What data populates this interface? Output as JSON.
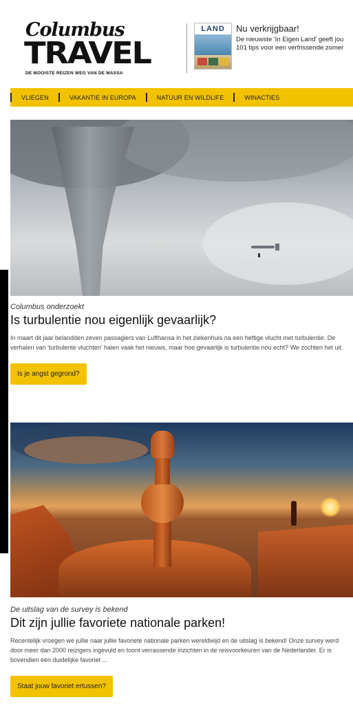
{
  "header": {
    "logo": {
      "script": "Columbus",
      "main": "TRAVEL",
      "tagline": "DE MOOISTE REIZEN WEG VAN DE MASSA"
    },
    "promo": {
      "magazine_masthead": "LAND",
      "title": "Nu verkrijgbaar!",
      "description": "De nieuwste 'In Eigen Land' geeft jou 101 tips voor een verfrissende zomer"
    }
  },
  "nav": {
    "items": [
      {
        "label": "VLIEGEN"
      },
      {
        "label": "VAKANTIE IN EUROPA"
      },
      {
        "label": "NATUUR EN WILDLIFE"
      },
      {
        "label": "WINACTIES"
      }
    ]
  },
  "articles": [
    {
      "kicker": "Columbus onderzoekt",
      "headline": "Is turbulentie nou eigenlijk gevaarlijk?",
      "body": "In maart dit jaar belandden zeven passagiers van Lufthansa in het ziekenhuis na een heftige vlucht met turbulentie. De verhalen van 'turbulente vluchten' halen vaak het nieuws, maar hoe gevaarlijk is turbulentie nou echt? We zochten het uit.",
      "cta": "Is je angst gegrond?"
    },
    {
      "kicker": "De uitslag van de survey is bekend",
      "headline": "Dit zijn jullie favoriete nationale parken!",
      "body": "Recentelijk vroegen we jullie naar jullie favoriete nationale parken wereldwijd en de uitslag is bekend! Onze survey werd door meer dan 2000 reizigers ingevuld en toont verrassende inzichten in de reisvoorkeuren van de Nederlander. Er is bovendien één duidelijke favoriet ...",
      "cta": "Staat jouw favoriet ertussen?"
    }
  ]
}
